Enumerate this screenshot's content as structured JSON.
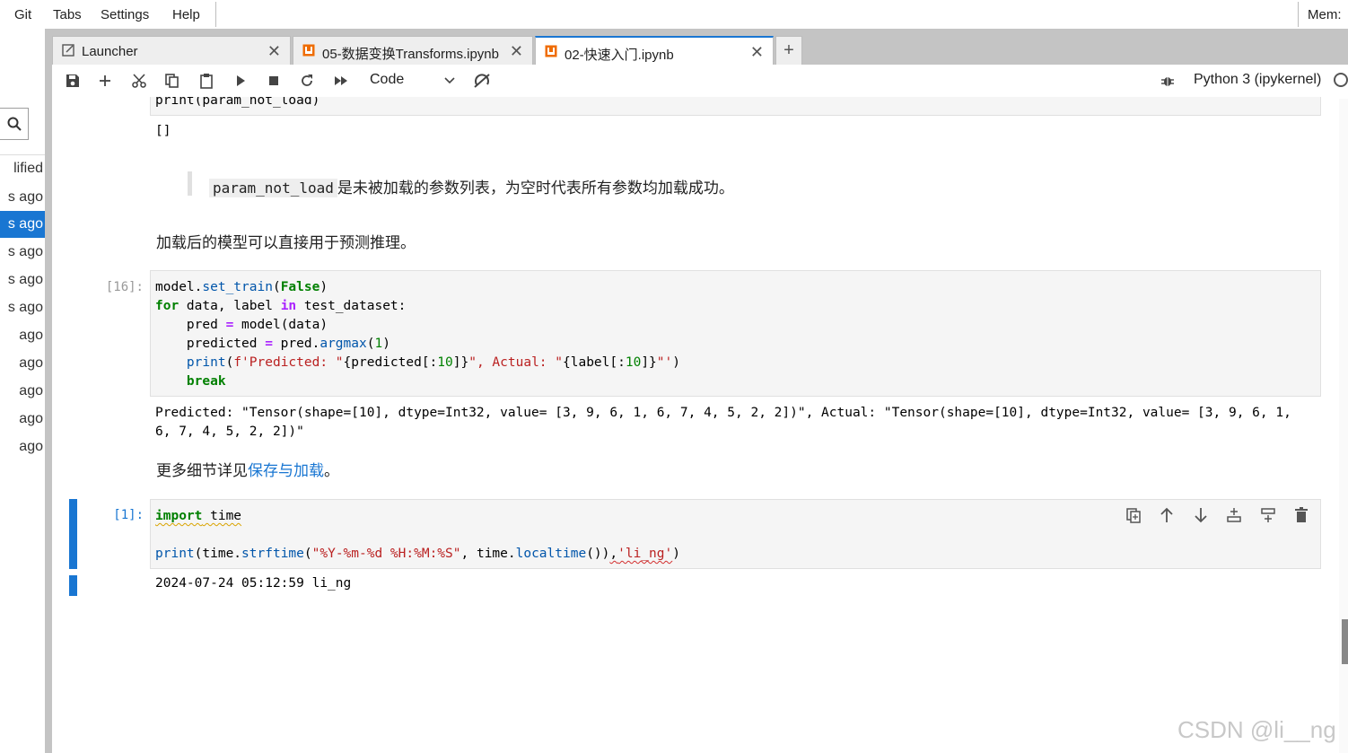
{
  "menu": {
    "items": [
      "Git",
      "Tabs",
      "Settings",
      "Help"
    ],
    "mem_label": "Mem:"
  },
  "file_browser": {
    "header": "lified",
    "rows": [
      "s ago",
      "s ago",
      "s ago",
      "s ago",
      "s ago",
      "ago",
      "ago",
      "ago",
      "ago",
      "ago"
    ],
    "selected_index": 1
  },
  "tabs": [
    {
      "label": "Launcher",
      "icon": "launcher-icon",
      "active": false
    },
    {
      "label": "05-数据变换Transforms.ipynb",
      "icon": "notebook-icon",
      "active": false
    },
    {
      "label": "02-快速入门.ipynb",
      "icon": "notebook-icon",
      "active": true
    }
  ],
  "toolbar": {
    "cell_type": "Code",
    "kernel": "Python 3 (ipykernel)",
    "icons": [
      "save-icon",
      "add-cell-icon",
      "cut-icon",
      "copy-icon",
      "paste-icon",
      "run-icon",
      "stop-icon",
      "restart-icon",
      "fast-forward-icon",
      "git-icon",
      "bug-icon"
    ]
  },
  "cells": {
    "prev_code_tail": "print(param_not_load)",
    "prev_output": "[]",
    "quote_code": "param_not_load",
    "quote_text": "是未被加载的参数列表，为空时代表所有参数均加载成功。",
    "md_after_quote": "加载后的模型可以直接用于预测推理。",
    "cell16_prompt": "[16]:",
    "cell16_output_line1": "Predicted: \"Tensor(shape=[10], dtype=Int32, value= [3, 9, 6, 1, 6, 7, 4, 5, 2, 2])\", Actual: \"Tensor(shape=[10], dtype=Int32, value= [3, 9, 6, 1,",
    "cell16_output_line2": "6, 7, 4, 5, 2, 2])\"",
    "md_more_prefix": "更多细节详见",
    "md_more_link": "保存与加载",
    "md_more_suffix": "。",
    "cell1_prompt": "[1]:",
    "cell1_output": "2024-07-24 05:12:59 li_ng"
  },
  "cell_toolbar_icons": [
    "duplicate-cell-icon",
    "move-up-icon",
    "move-down-icon",
    "insert-above-icon",
    "insert-below-icon",
    "delete-cell-icon"
  ],
  "watermark": "CSDN @li__ng"
}
